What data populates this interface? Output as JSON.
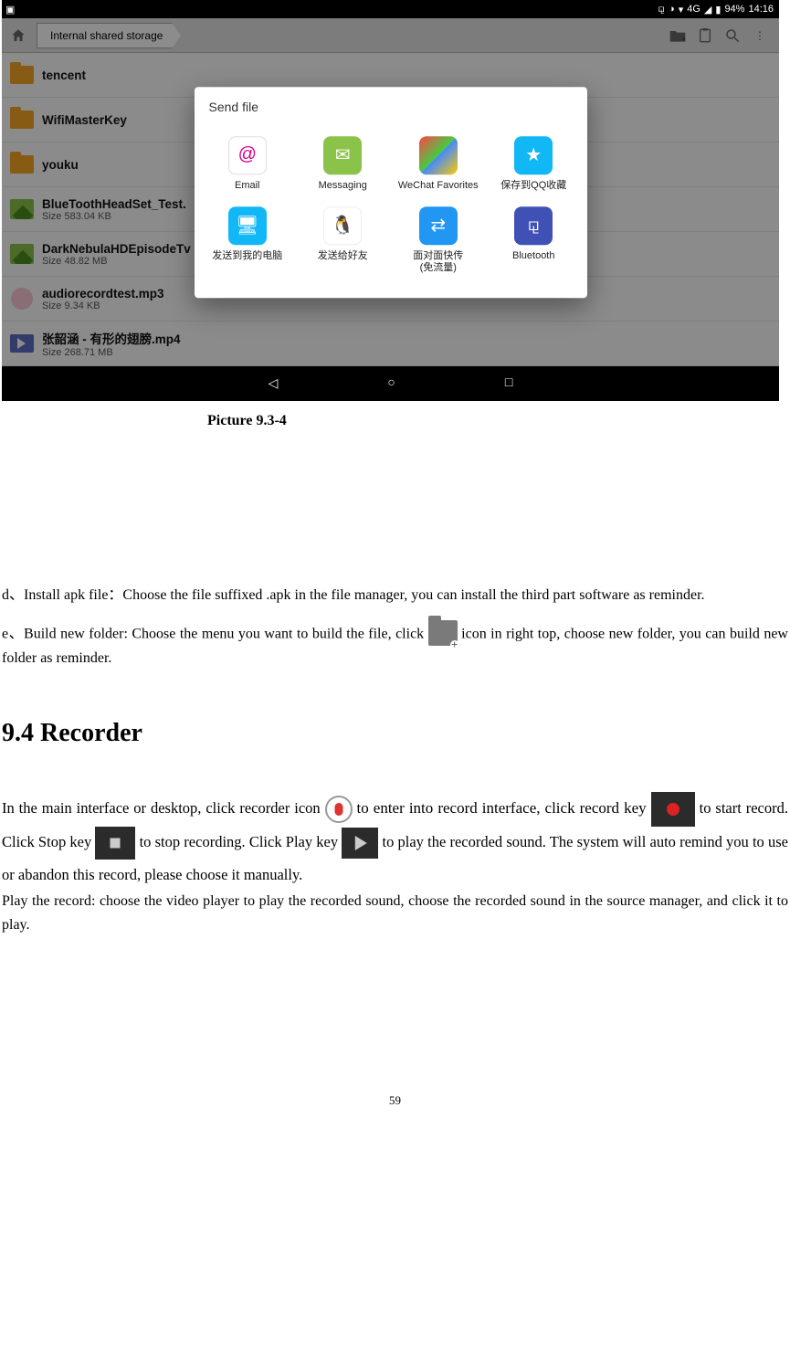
{
  "status": {
    "battery": "94%",
    "time": "14:16",
    "net": "4G"
  },
  "breadcrumb": "Internal shared storage",
  "files": [
    {
      "name": "tencent",
      "type": "folder"
    },
    {
      "name": "WifiMasterKey",
      "type": "folder"
    },
    {
      "name": "youku",
      "type": "folder"
    },
    {
      "name": "BlueToothHeadSet_Test.",
      "sub": "Size 583.04 KB",
      "type": "image"
    },
    {
      "name": "DarkNebulaHDEpisodeTv",
      "sub": "Size 48.82 MB",
      "type": "image"
    },
    {
      "name": "audiorecordtest.mp3",
      "sub": "Size 9.34 KB",
      "type": "audio"
    },
    {
      "name": "张韶涵 - 有形的翅膀.mp4",
      "sub": "Size 268.71 MB",
      "type": "video"
    }
  ],
  "modal_title": "Send file",
  "share_targets": [
    {
      "label": "Email",
      "color": "#f5f5f5",
      "glyph": "✉"
    },
    {
      "label": "Messaging",
      "color": "#8bc34a",
      "glyph": "💬"
    },
    {
      "label": "WeChat Favorites",
      "color": "#ffffff",
      "glyph": "◆"
    },
    {
      "label": "保存到QQ收藏",
      "color": "#12b7f5",
      "glyph": "★"
    },
    {
      "label": "发送到我的电脑",
      "color": "#12b7f5",
      "glyph": "🖥"
    },
    {
      "label": "发送给好友",
      "color": "#ffffff",
      "glyph": "🐧"
    },
    {
      "label": "面对面快传\n(免流量)",
      "color": "#2196f3",
      "glyph": "📶"
    },
    {
      "label": "Bluetooth",
      "color": "#3f51b5",
      "glyph": "✱"
    }
  ],
  "caption": "Picture 9.3-4",
  "para_d": "d、Install apk file：Choose the file suffixed .apk in the file manager, you can install the third part software as reminder.",
  "para_e_1": "e、Build new folder: Choose the menu you want to build the file, click ",
  "para_e_2": " icon in right top, choose new folder, you can build new folder as reminder.",
  "heading": "9.4   Recorder",
  "rec_1": "In the main interface or desktop, click recorder icon ",
  "rec_2": " to enter into record interface, click record key ",
  "rec_3": " to start record. Click Stop key ",
  "rec_4": " to stop recording. Click Play key ",
  "rec_5": " to play the recorded sound. The system will auto remind you to use or abandon this record, please choose it manually.",
  "rec_play": "Play the record: choose the video player to play the recorded sound, choose the recorded sound in the source manager, and click it to play.",
  "page_number": "59"
}
